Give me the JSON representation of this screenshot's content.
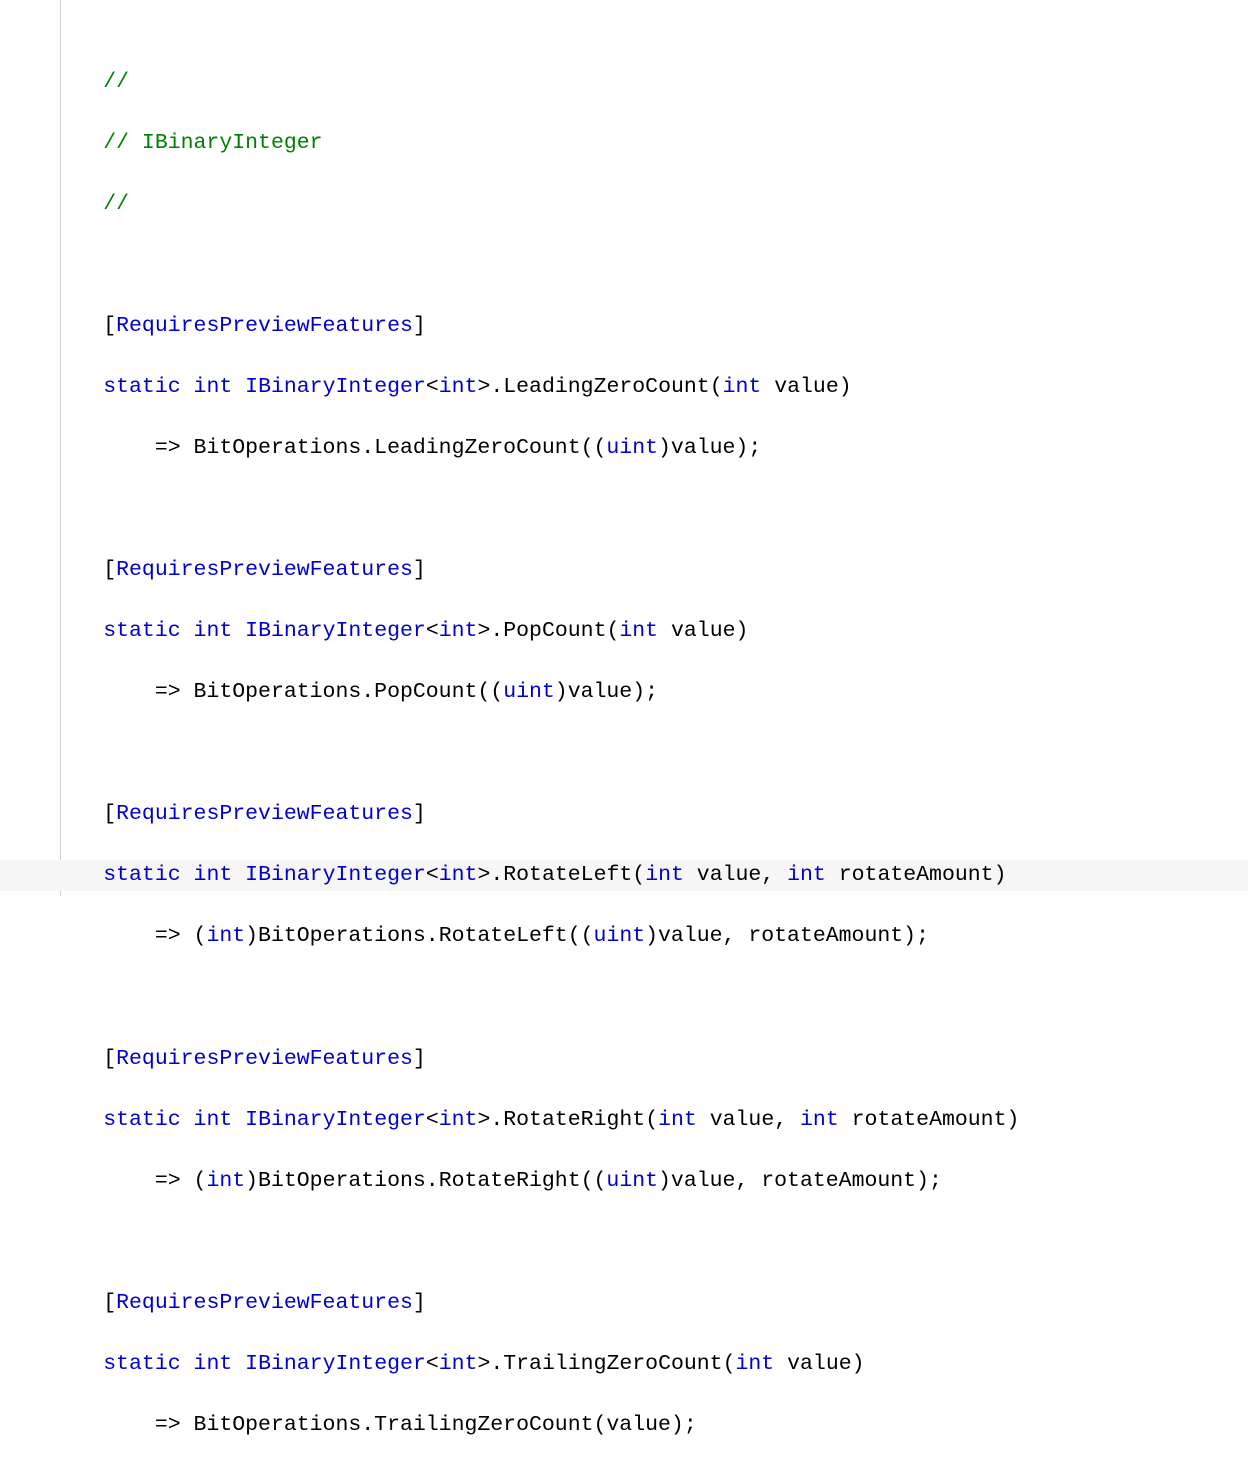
{
  "code": {
    "comment_blank1": "//",
    "comment_header": "// IBinaryInteger",
    "comment_blank2": "//",
    "attr_open": "[",
    "attr_name": "RequiresPreviewFeatures",
    "attr_close": "]",
    "kw_static": "static",
    "kw_int": "int",
    "iface": "IBinaryInteger",
    "lt": "<",
    "gt": ">",
    "dot": ".",
    "method1": "LeadingZeroCount",
    "method2": "PopCount",
    "method3": "RotateLeft",
    "method4": "RotateRight",
    "method5": "TrailingZeroCount",
    "p_open": "(",
    "p_close": ")",
    "p_value": " value",
    "p_value_comma": " value, ",
    "p_rotate": " rotateAmount",
    "arrow": "=> ",
    "bitops": "BitOperations",
    "cast_uint": "uint",
    "cast_int": "int",
    "arg_value": "value",
    "arg_value_rotate": "value, rotateAmount",
    "semi": ";",
    "body1": "=> BitOperations.LeadingZeroCount((",
    "body1b": ")value);",
    "body2": "=> BitOperations.PopCount((",
    "body2b": ")value);",
    "body3a": "=> (",
    "body3b": ")BitOperations.RotateLeft((",
    "body3c": ")value, rotateAmount);",
    "body4b": ")BitOperations.RotateRight((",
    "body4c": ")value, rotateAmount);",
    "body5": "=> BitOperations.TrailingZeroCount(value);"
  }
}
